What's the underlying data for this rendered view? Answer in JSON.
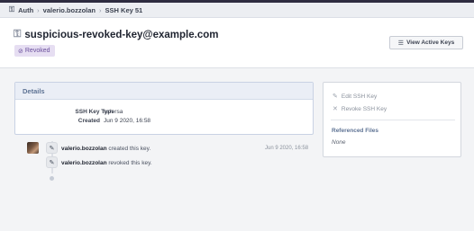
{
  "breadcrumbs": [
    "Auth",
    "valerio.bozzolan",
    "SSH Key 51"
  ],
  "header": {
    "title": "suspicious-revoked-key@example.com",
    "status_badge": "Revoked",
    "view_button": "View Active Keys"
  },
  "details": {
    "heading": "Details",
    "properties": [
      {
        "label": "SSH Key Type",
        "value": "ssh-rsa"
      },
      {
        "label": "Created",
        "value": "Jun 9 2020, 16:58"
      }
    ]
  },
  "actions": {
    "edit": "Edit SSH Key",
    "revoke": "Revoke SSH Key",
    "referenced_heading": "Referenced Files",
    "referenced_value": "None"
  },
  "timeline": [
    {
      "user": "valerio.bozzolan",
      "text": "created this key.",
      "date": "Jun 9 2020, 16:58"
    },
    {
      "user": "valerio.bozzolan",
      "text": "revoked this key."
    }
  ]
}
